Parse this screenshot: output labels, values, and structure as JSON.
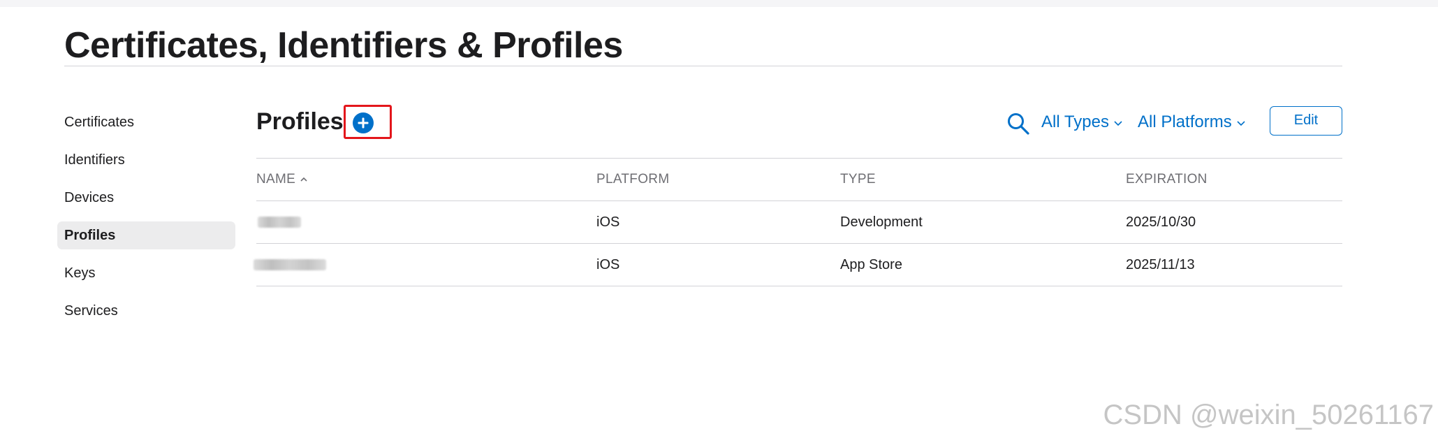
{
  "page": {
    "title": "Certificates, Identifiers & Profiles"
  },
  "sidebar": {
    "items": [
      {
        "label": "Certificates"
      },
      {
        "label": "Identifiers"
      },
      {
        "label": "Devices"
      },
      {
        "label": "Profiles",
        "active": true
      },
      {
        "label": "Keys"
      },
      {
        "label": "Services"
      }
    ]
  },
  "section": {
    "title": "Profiles",
    "add_icon": "plus-circle-icon"
  },
  "toolbar": {
    "search_icon": "search-icon",
    "type_filter": "All Types",
    "platform_filter": "All Platforms",
    "edit_label": "Edit"
  },
  "table": {
    "columns": [
      "NAME",
      "PLATFORM",
      "TYPE",
      "EXPIRATION"
    ],
    "sort_icon": "chevron-up-icon",
    "rows": [
      {
        "name": "",
        "platform": "iOS",
        "type": "Development",
        "expiration": "2025/10/30"
      },
      {
        "name": "",
        "platform": "iOS",
        "type": "App Store",
        "expiration": "2025/11/13"
      }
    ]
  },
  "watermark": "CSDN @weixin_50261167",
  "colors": {
    "accent": "#0070c9",
    "highlight_box": "#e3161b",
    "active_bg": "#ececed"
  }
}
